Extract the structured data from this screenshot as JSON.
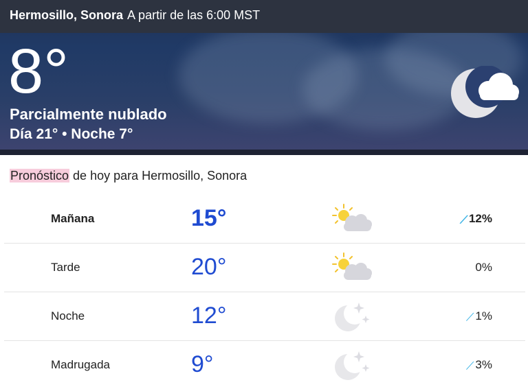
{
  "location": {
    "city": "Hermosillo, Sonora",
    "updated": "A partir de las 6:00 MST"
  },
  "current": {
    "temperature": "8°",
    "condition": "Parcialmente nublado",
    "day_night": "Día 21° • Noche 7°",
    "icon": "moon-cloud-icon"
  },
  "forecast": {
    "title_highlight": "Pronóstico",
    "title_rest": " de hoy para Hermosillo, Sonora",
    "rows": [
      {
        "period": "Mañana",
        "temp": "15°",
        "icon": "partly-cloudy-sun-icon",
        "precip": "12%",
        "show_drop": true,
        "bold": true
      },
      {
        "period": "Tarde",
        "temp": "20°",
        "icon": "partly-cloudy-sun-icon",
        "precip": "0%",
        "show_drop": false,
        "bold": false
      },
      {
        "period": "Noche",
        "temp": "12°",
        "icon": "moon-stars-icon",
        "precip": "1%",
        "show_drop": true,
        "bold": false
      },
      {
        "period": "Madrugada",
        "temp": "9°",
        "icon": "moon-stars-icon",
        "precip": "3%",
        "show_drop": true,
        "bold": false
      }
    ]
  },
  "colors": {
    "temp_blue": "#1f4bd1",
    "highlight_pink": "#f7cddc",
    "drop_blue": "#3bb3e6"
  }
}
